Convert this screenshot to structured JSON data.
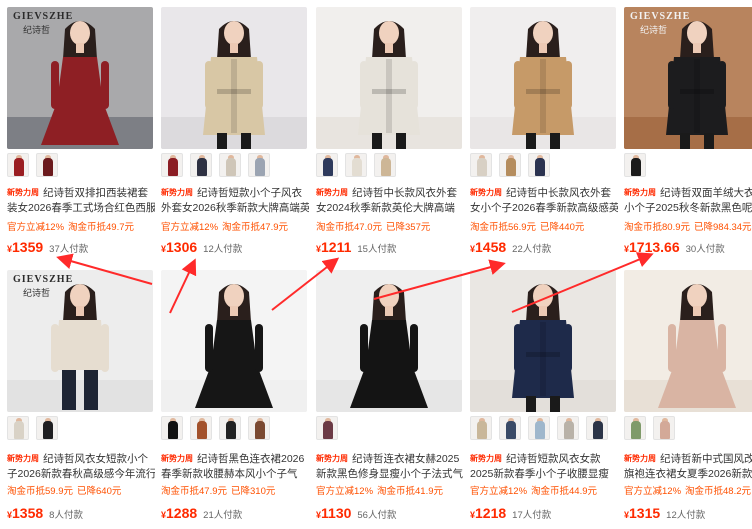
{
  "products": [
    {
      "brand": "GIEVSZHE",
      "brand_cn": "纪诗哲",
      "title": "纪诗哲双排扣西装裙套装女2026春季工式场合红色西服",
      "promos": [
        "官方立减12%",
        "淘金币抵49.7元"
      ],
      "price_currency": "¥",
      "price": "1359",
      "sold": "37人付款",
      "colors": {
        "bg": "#a9a9ab",
        "garment": "#8e1f24",
        "ground": "#7d7f85"
      },
      "thumb_colors": [
        "#9a1e22",
        "#6b1a1d"
      ]
    },
    {
      "brand": "",
      "brand_cn": "",
      "title": "纪诗哲短款小个子风衣外套女2026秋季新款大牌高端英伦风",
      "promos": [
        "官方立减12%",
        "淘金币抵47.9元"
      ],
      "price_currency": "¥",
      "price": "1306",
      "sold": "12人付款",
      "colors": {
        "bg": "#e9e7ea",
        "garment": "#d8c7a5",
        "ground": "#dcdadd"
      },
      "thumb_colors": [
        "#8b1d24",
        "#2e3142",
        "#cfc6b8",
        "#9ba4b2"
      ]
    },
    {
      "brand": "",
      "brand_cn": "",
      "title": "纪诗哲中长款风衣外套女2024秋季新款英伦大牌高端",
      "promos": [
        "淘金币抵47.0元",
        "已降357元"
      ],
      "price_currency": "¥",
      "price": "1211",
      "sold": "15人付款",
      "colors": {
        "bg": "#f1efed",
        "garment": "#e6e2da",
        "ground": "#e8e4df"
      },
      "thumb_colors": [
        "#2e3a5c",
        "#e3ddd2",
        "#cdb696"
      ]
    },
    {
      "brand": "",
      "brand_cn": "",
      "title": "纪诗哲中长款风衣外套女小个子2026春季新款高级感英",
      "promos": [
        "淘金币抵56.9元",
        "已降440元"
      ],
      "price_currency": "¥",
      "price": "1458",
      "sold": "22人付款",
      "colors": {
        "bg": "#f0eeee",
        "garment": "#c69a68",
        "ground": "#e9e6e6"
      },
      "thumb_colors": [
        "#d8d0c4",
        "#b58d5e",
        "#2b3350"
      ]
    },
    {
      "brand": "GIEVSZHE",
      "brand_cn": "纪诗哲",
      "title": "纪诗哲双面羊绒大衣女小个子2025秋冬新款黑色呢子",
      "promos": [
        "淘金币抵80.9元",
        "已降984.34元"
      ],
      "price_currency": "¥",
      "price": "1713.66",
      "sold": "30人付款",
      "colors": {
        "bg": "#b8845e",
        "garment": "#1c1c1e",
        "ground": "#a66e47"
      },
      "thumb_colors": [
        "#1b1b1b"
      ]
    },
    {
      "brand": "GIEVSZHE",
      "brand_cn": "纪诗哲",
      "title": "纪诗哲风衣女短款小个子2026新款春秋高级感今年流行",
      "promos": [
        "淘金币抵59.9元",
        "已降640元"
      ],
      "price_currency": "¥",
      "price": "1358",
      "sold": "8人付款",
      "colors": {
        "bg": "#ededed",
        "garment": "#e6ddd0",
        "ground": "#e2e2e2"
      },
      "thumb_colors": [
        "#d9d2c6",
        "#1f1f22"
      ]
    },
    {
      "brand": "",
      "brand_cn": "",
      "title": "纪诗哲黑色连衣裙2026春季新款收腰赫本风小个子气",
      "promos": [
        "淘金币抵47.9元",
        "已降310元"
      ],
      "price_currency": "¥",
      "price": "1288",
      "sold": "21人付款",
      "colors": {
        "bg": "#f4f4f4",
        "garment": "#161616",
        "ground": "#f0f0f0"
      },
      "thumb_colors": [
        "#111111",
        "#a3522c",
        "#222222",
        "#7b4a32"
      ]
    },
    {
      "brand": "",
      "brand_cn": "",
      "title": "纪诗哲连衣裙女赫2025新款黑色修身显瘦小个子法式气",
      "promos": [
        "官方立减12%",
        "淘金币抵41.9元"
      ],
      "price_currency": "¥",
      "price": "1130",
      "sold": "56人付款",
      "colors": {
        "bg": "#efefef",
        "garment": "#141414",
        "ground": "#e6e6e6"
      },
      "thumb_colors": [
        "#6b3a45"
      ]
    },
    {
      "brand": "",
      "brand_cn": "",
      "title": "纪诗哲短款风衣女款2025新款春季小个子收腰显瘦",
      "promos": [
        "官方立减12%",
        "淘金币抵44.9元"
      ],
      "price_currency": "¥",
      "price": "1218",
      "sold": "17人付款",
      "colors": {
        "bg": "#eae7e3",
        "garment": "#1e2a4a",
        "ground": "#e3dfda"
      },
      "thumb_colors": [
        "#c9b79a",
        "#3a4a66",
        "#9fb7cc",
        "#b9b2a8",
        "#2b3447"
      ]
    },
    {
      "brand": "",
      "brand_cn": "",
      "title": "纪诗哲新中式国风改良旗袍连衣裙女夏季2026新款中式",
      "promos": [
        "官方立减12%",
        "淘金币抵48.2元"
      ],
      "price_currency": "¥",
      "price": "1315",
      "sold": "12人付款",
      "colors": {
        "bg": "#f2ece4",
        "garment": "#d9b4a3",
        "ground": "#e8e0d6"
      },
      "thumb_colors": [
        "#7f9a6a",
        "#d3a998"
      ]
    }
  ],
  "promo_tag": "新势力周",
  "annotation_color": "#ff2a2a"
}
